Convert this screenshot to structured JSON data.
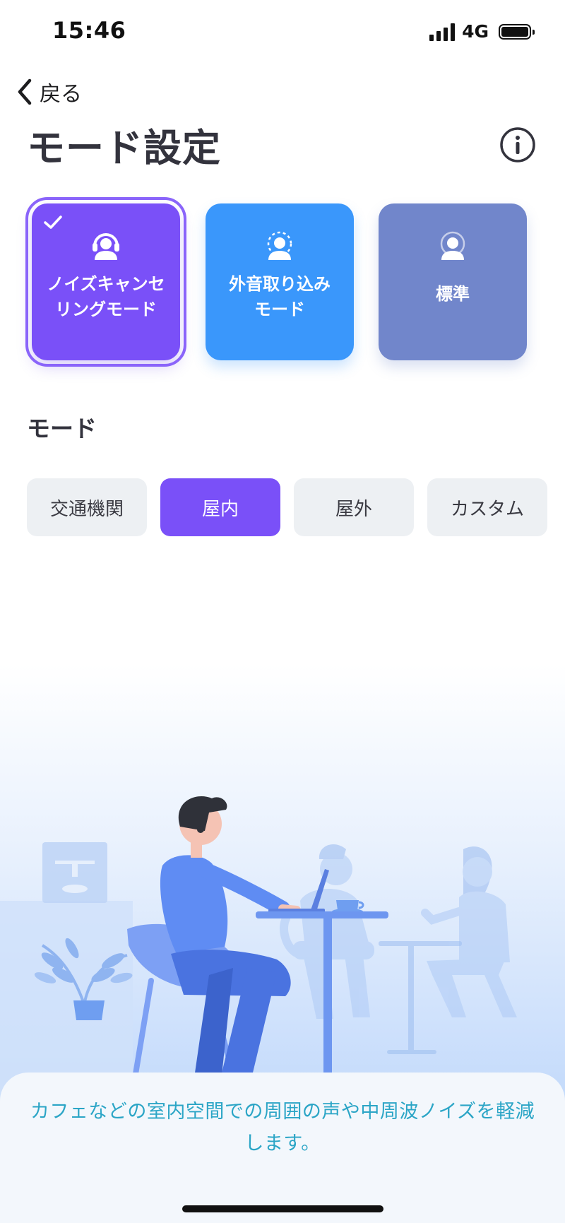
{
  "status_bar": {
    "time": "15:46",
    "network": "4G"
  },
  "nav": {
    "back_label": "戻る"
  },
  "page": {
    "title": "モード設定"
  },
  "mode_cards": [
    {
      "label": "ノイズキャンセ\nリングモード",
      "selected": true,
      "icon": "user-headphones-icon"
    },
    {
      "label": "外音取り込み\nモード",
      "selected": false,
      "icon": "user-dashed-ring-icon"
    },
    {
      "label": "標準",
      "selected": false,
      "icon": "user-ring-icon"
    }
  ],
  "section": {
    "title": "モード"
  },
  "presets": [
    {
      "label": "交通機関",
      "active": false
    },
    {
      "label": "屋内",
      "active": true
    },
    {
      "label": "屋外",
      "active": false
    },
    {
      "label": "カスタム",
      "active": false
    }
  ],
  "description": "カフェなどの室内空間での周囲の声や中周波ノイズを軽減します。",
  "colors": {
    "accent_purple": "#7a50f8",
    "ambient_blue": "#3a97fb",
    "standard_slate": "#7186cb",
    "description_text": "#2ba5c6",
    "preset_inactive_bg": "#edf0f3"
  }
}
